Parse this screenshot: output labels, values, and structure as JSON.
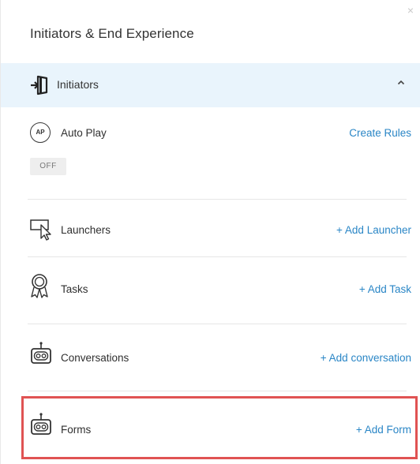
{
  "panel": {
    "title": "Initiators & End Experience",
    "close_glyph": "×"
  },
  "section": {
    "label": "Initiators",
    "icon": "door-enter-icon",
    "expanded": true
  },
  "rows": {
    "auto_play": {
      "icon_text": "AP",
      "label": "Auto Play",
      "action": "Create Rules",
      "toggle_state": "OFF"
    },
    "launchers": {
      "icon": "launcher-cursor-icon",
      "label": "Launchers",
      "action": "+ Add Launcher"
    },
    "tasks": {
      "icon": "award-ribbon-icon",
      "label": "Tasks",
      "action": "+ Add Task"
    },
    "conversations": {
      "icon": "robot-icon",
      "label": "Conversations",
      "action": "+ Add conversation"
    },
    "forms": {
      "icon": "robot-icon",
      "label": "Forms",
      "action": "+ Add Form"
    }
  },
  "colors": {
    "accent_link": "#2a86c6",
    "section_bg": "#e9f4fc",
    "highlight": "#e05353",
    "badge_bg": "#eeeeee"
  }
}
